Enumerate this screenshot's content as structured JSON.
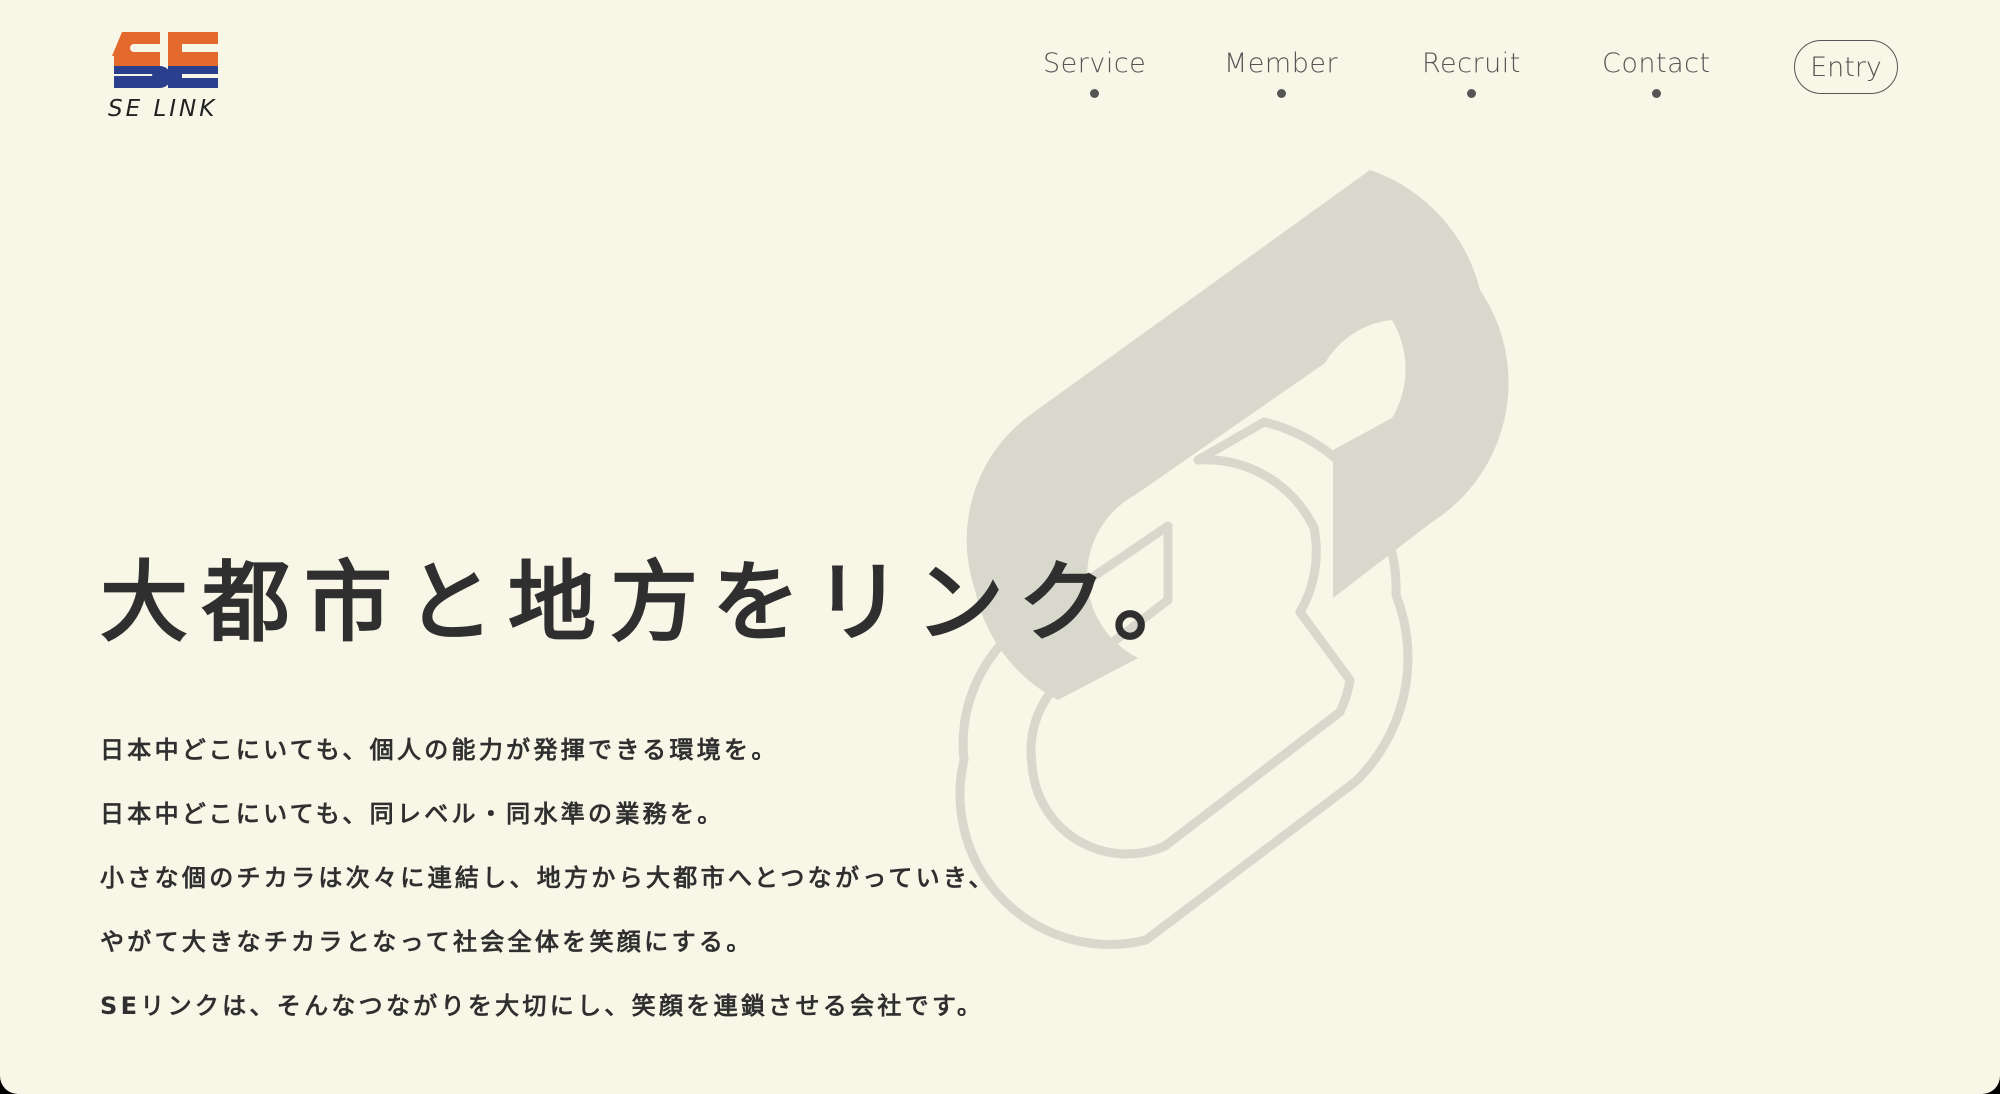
{
  "brand": {
    "logo_text": "SE LINK",
    "colors": {
      "orange": "#e3692c",
      "blue": "#2b3f8f",
      "background": "#f7f6e7",
      "text": "#2f2f2f",
      "chain": "#d8d9cc"
    }
  },
  "nav": {
    "items": [
      {
        "label": "Service"
      },
      {
        "label": "Member"
      },
      {
        "label": "Recruit"
      },
      {
        "label": "Contact"
      }
    ],
    "entry_label": "Entry"
  },
  "hero": {
    "title": "大都市と地方をリンク。",
    "lines": [
      "日本中どこにいても、個人の能力が発揮できる環境を。",
      "日本中どこにいても、同レベル・同水準の業務を。",
      "小さな個のチカラは次々に連結し、地方から大都市へとつながっていき、",
      "やがて大きなチカラとなって社会全体を笑顔にする。",
      "SEリンクは、そんなつながりを大切にし、笑顔を連鎖させる会社です。"
    ]
  },
  "decoration": {
    "background_icon": "chain-link-icon"
  }
}
